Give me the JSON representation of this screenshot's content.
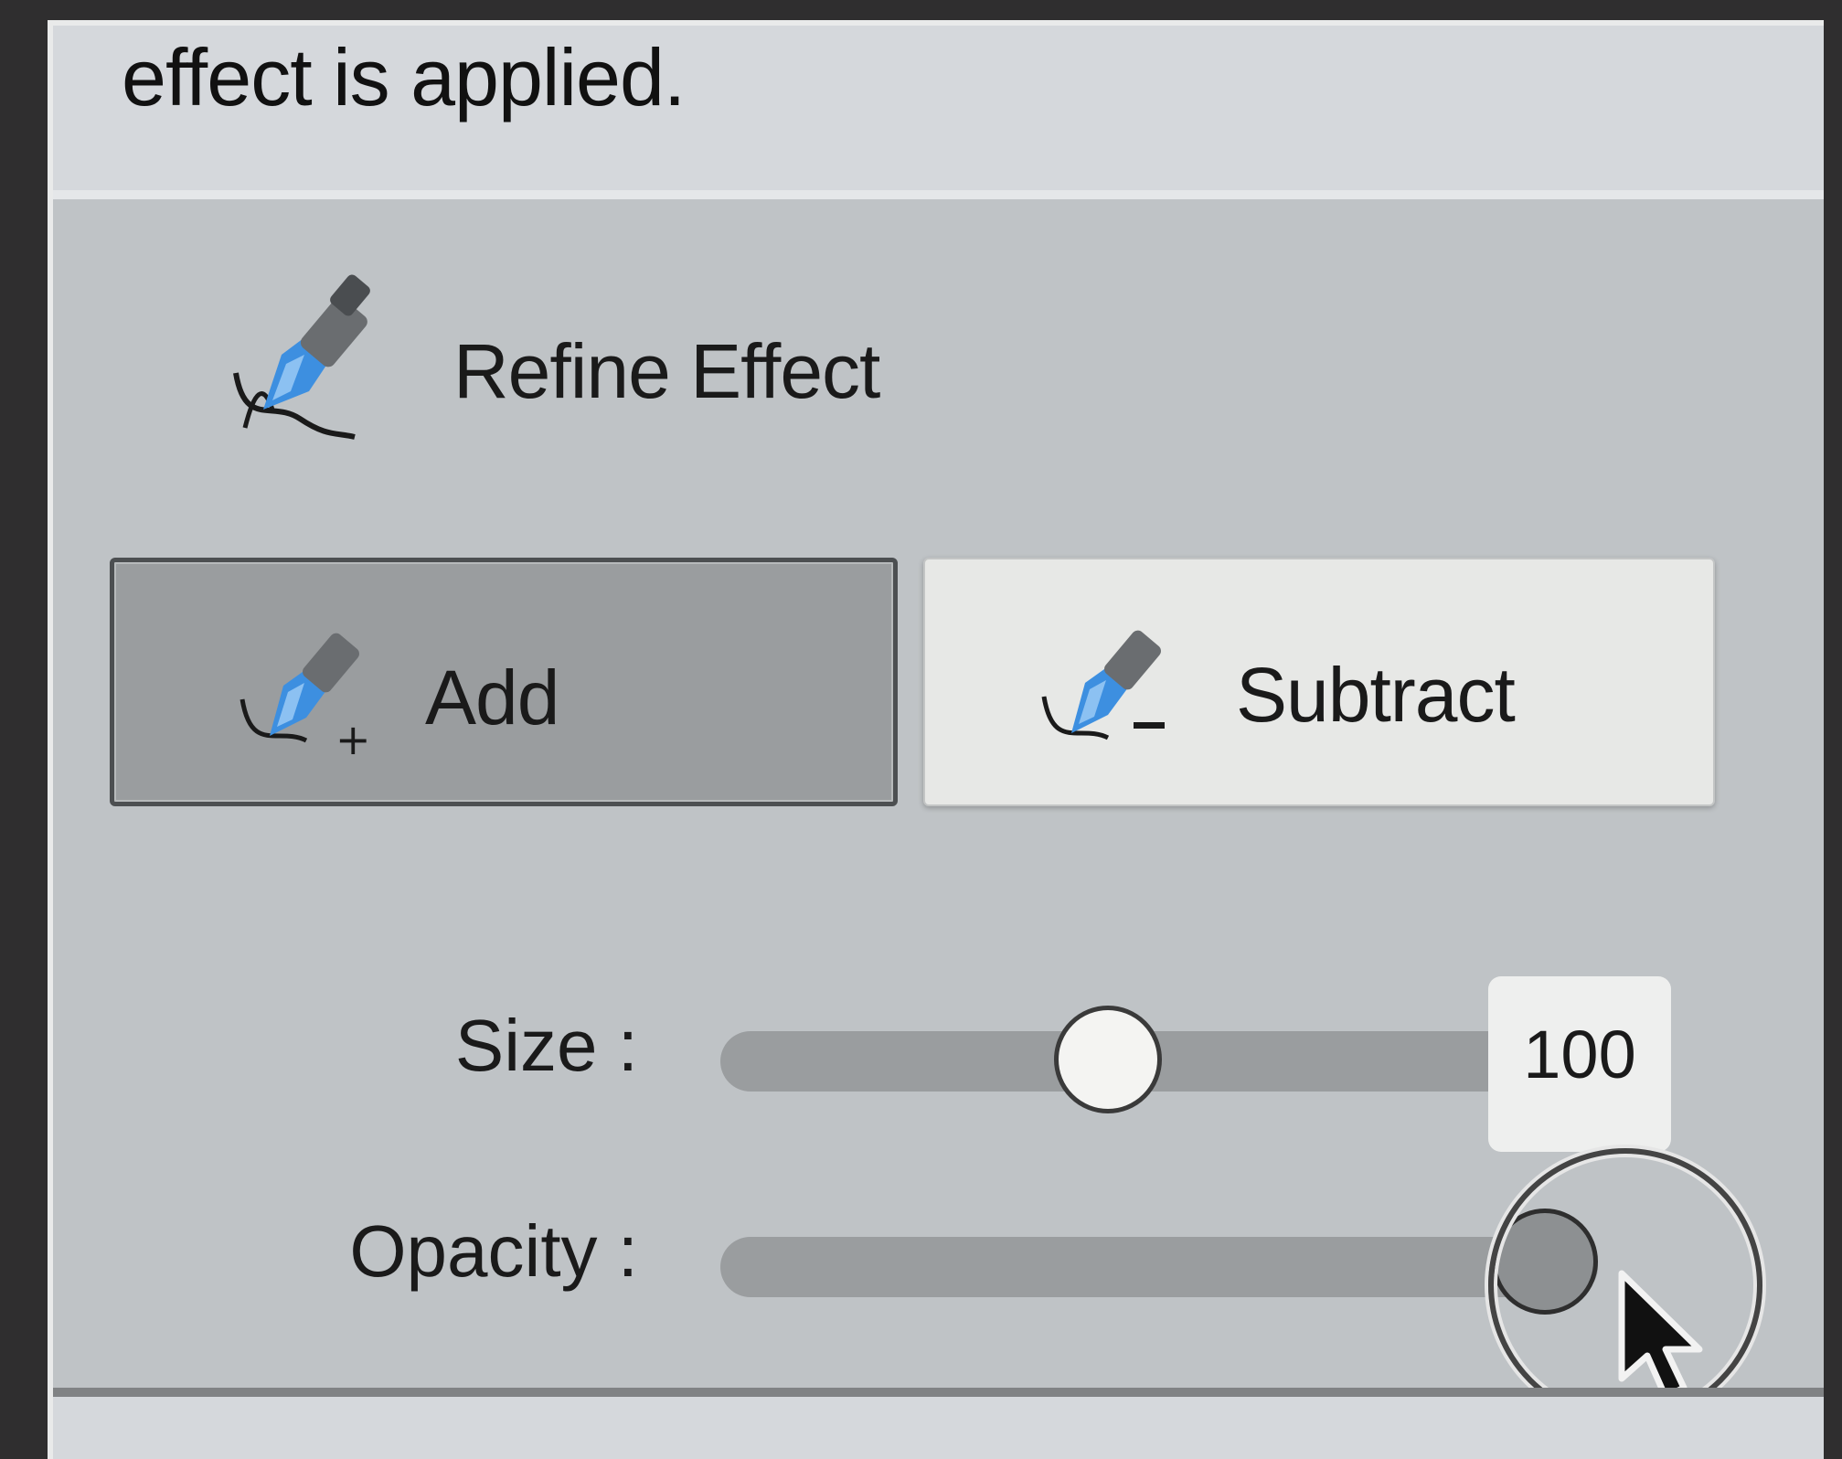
{
  "info_text": "effect is applied.",
  "section": {
    "title": "Refine Effect",
    "icon": "brush-icon"
  },
  "buttons": {
    "add_label": "Add",
    "subtract_label": "Subtract",
    "add_icon": "brush-add-icon",
    "subtract_icon": "brush-subtract-icon",
    "selected": "Add"
  },
  "sliders": {
    "size_label": "Size :",
    "size_value": "100",
    "size_level": 0.5,
    "opacity_label": "Opacity :",
    "opacity_level": 1.0
  },
  "colors": {
    "panel_bg": "#bfc3c6",
    "track": "#9a9d9f",
    "brush_blue": "#3d8fe0"
  }
}
